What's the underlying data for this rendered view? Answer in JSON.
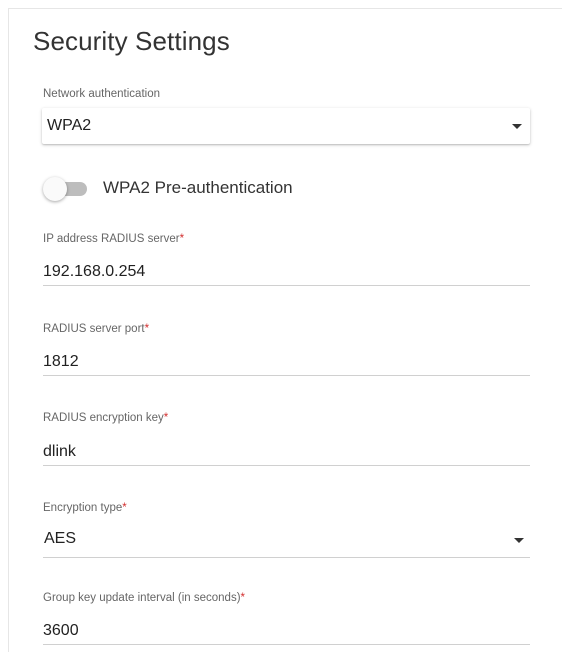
{
  "section": {
    "title": "Security Settings"
  },
  "network_authentication": {
    "label": "Network authentication",
    "value": "WPA2"
  },
  "pre_authentication": {
    "label": "WPA2 Pre-authentication",
    "enabled": false
  },
  "radius_ip": {
    "label": "IP address RADIUS server",
    "required_mark": "*",
    "value": "192.168.0.254"
  },
  "radius_port": {
    "label": "RADIUS server port",
    "required_mark": "*",
    "value": "1812"
  },
  "radius_key": {
    "label": "RADIUS encryption key",
    "required_mark": "*",
    "value": "dlink"
  },
  "encryption_type": {
    "label": "Encryption type",
    "required_mark": "*",
    "value": "AES"
  },
  "group_key_interval": {
    "label": "Group key update interval (in seconds)",
    "required_mark": "*",
    "value": "3600"
  },
  "colors": {
    "required": "#d32f2f",
    "toggle_off_track": "#bdbdbd"
  },
  "icons": {
    "dropdown": "chevron-down-icon"
  }
}
